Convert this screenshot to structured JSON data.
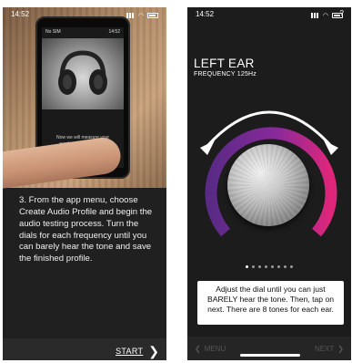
{
  "left_screen": {
    "status_time": "14:52",
    "inner_status_carrier": "No SIM",
    "inner_status_time": "14:52",
    "inner_text": "Now we will measure your ears' sensitivity to each frequency",
    "description": "3. From the app menu, choose Create Audio Profile and begin the audio testing process. Turn the dials for each frequency until you can barely hear the tone and save the finished profile.",
    "start_label": "START"
  },
  "right_screen": {
    "status_time": "14:52",
    "help_label": "?",
    "ear_title": "LEFT EAR",
    "frequency": "FREQUENCY 125Hz",
    "page_dots_total": 8,
    "page_dots_active": 1,
    "instruction": "Adjust the dial until you can just BARELY hear the tone. Then, tap on next. There are 8 tones for each ear.",
    "menu_label": "MENU",
    "next_label": "NEXT"
  },
  "colors": {
    "gauge_start": "#6a2c8c",
    "gauge_end": "#d4267a"
  }
}
